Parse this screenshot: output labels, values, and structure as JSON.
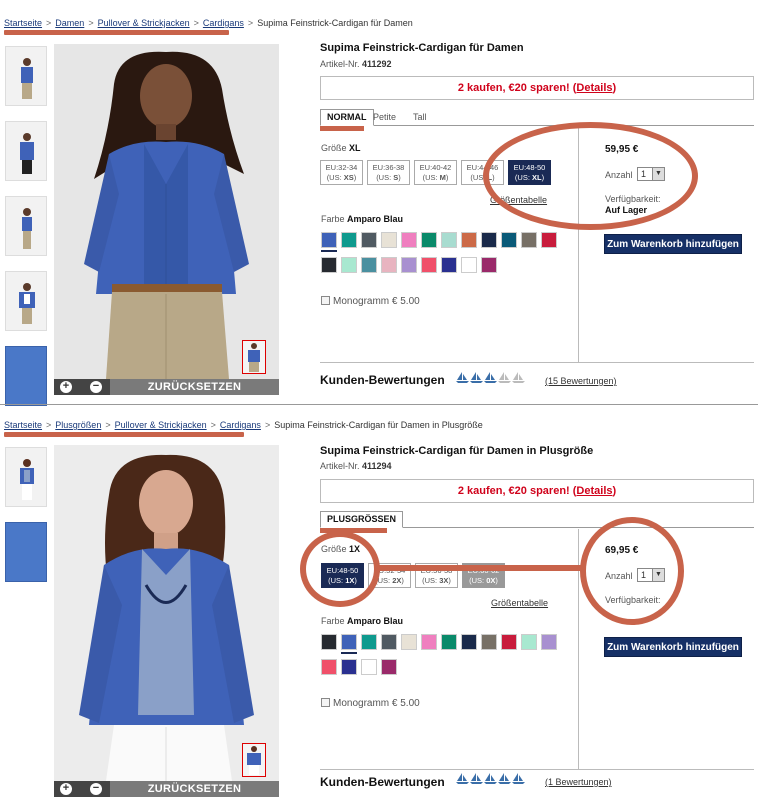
{
  "colors": {
    "highlight": "#c8634a",
    "navy": "#1a2a55",
    "promo_red": "#d0021b",
    "cart_button": "#163066",
    "boat_blue": "#3a6ea8",
    "boat_grey": "#bbbbbb"
  },
  "panel1": {
    "breadcrumb": {
      "links": [
        "Startseite",
        "Damen",
        "Pullover & Strickjacken",
        "Cardigans"
      ],
      "current": "Supima Feinstrick-Cardigan für Damen",
      "separator": ">"
    },
    "product_title": "Supima Feinstrick-Cardigan für Damen",
    "article_label": "Artikel-Nr.",
    "article_number": "411292",
    "promo_text": "2 kaufen, €20 sparen! (",
    "promo_link": "Details",
    "promo_close": ")",
    "tabs": [
      "NORMAL",
      "Petite",
      "Tall"
    ],
    "size_label": "Größe",
    "size_selected": "XL",
    "sizes": [
      {
        "eu": "EU:32-34",
        "us_prefix": "(US: ",
        "us": "XS",
        "us_suffix": ")",
        "state": "normal"
      },
      {
        "eu": "EU:36-38",
        "us_prefix": "(US: ",
        "us": "S",
        "us_suffix": ")",
        "state": "normal"
      },
      {
        "eu": "EU:40-42",
        "us_prefix": "(US: ",
        "us": "M",
        "us_suffix": ")",
        "state": "normal"
      },
      {
        "eu": "EU:44-46",
        "us_prefix": "(US: ",
        "us": "L",
        "us_suffix": ")",
        "state": "normal"
      },
      {
        "eu": "EU:48-50",
        "us_prefix": "(US: ",
        "us": "XL",
        "us_suffix": ")",
        "state": "selected"
      }
    ],
    "size_chart_link": "Größentabelle",
    "color_label": "Farbe",
    "color_selected": "Amparo Blau",
    "swatches": [
      "#3f62b8",
      "#0f9a8e",
      "#505a62",
      "#e8e2d6",
      "#ef7fbf",
      "#0a8a6a",
      "#a8dcd0",
      "#cc6a48",
      "#1a2a4a",
      "#0a5a78",
      "#777066",
      "#c81c3c",
      "#262a30",
      "#a8e8d0",
      "#4a90a0",
      "#e8b4c0",
      "#a890d0",
      "#f0506a",
      "#2a3090",
      "#ffffff",
      "#9a2a6a"
    ],
    "monogram_label": "Monogramm € 5.00",
    "price": "59,95 €",
    "qty_label": "Anzahl",
    "qty_value": "1",
    "availability_label": "Verfügbarkeit:",
    "availability_value": "Auf Lager",
    "cart_button": "Zum Warenkorb hinzufügen",
    "reviews_title": "Kunden-Bewertungen",
    "rating": 3,
    "rating_max": 5,
    "reviews_link": "(15 Bewertungen)",
    "reset_label": "ZURÜCKSETZEN",
    "zoom_in": "+",
    "zoom_out": "−"
  },
  "panel2": {
    "breadcrumb": {
      "links": [
        "Startseite",
        "Plusgrößen",
        "Pullover & Strickjacken",
        "Cardigans"
      ],
      "current": "Supima Feinstrick-Cardigan für Damen in Plusgröße",
      "separator": ">"
    },
    "product_title": "Supima Feinstrick-Cardigan für Damen in Plusgröße",
    "article_label": "Artikel-Nr.",
    "article_number": "411294",
    "promo_text": "2 kaufen, €20 sparen! (",
    "promo_link": "Details",
    "promo_close": ")",
    "tabs": [
      "PLUSGRÖSSEN"
    ],
    "size_label": "Größe",
    "size_selected": "1X",
    "sizes": [
      {
        "eu": "EU:48-50",
        "us_prefix": "(US: ",
        "us": "1X",
        "us_suffix": ")",
        "state": "selected"
      },
      {
        "eu": "EU:52-54",
        "us_prefix": "(US: ",
        "us": "2X",
        "us_suffix": ")",
        "state": "normal"
      },
      {
        "eu": "EU:56-58",
        "us_prefix": "(US: ",
        "us": "3X",
        "us_suffix": ")",
        "state": "normal"
      },
      {
        "eu": "EU:60-62",
        "us_prefix": "(US: ",
        "us": "0X",
        "us_suffix": ")",
        "state": "unavailable"
      }
    ],
    "size_chart_link": "Größentabelle",
    "color_label": "Farbe",
    "color_selected": "Amparo Blau",
    "swatches": [
      "#262a30",
      "#3f62b8",
      "#0f9a8e",
      "#505a62",
      "#e8e2d6",
      "#ef7fbf",
      "#0a8a6a",
      "#1a2a4a",
      "#777066",
      "#c81c3c",
      "#a8e8d0",
      "#a890d0",
      "#f0506a",
      "#2a3090",
      "#ffffff",
      "#9a2a6a"
    ],
    "monogram_label": "Monogramm € 5.00",
    "price": "69,95 €",
    "qty_label": "Anzahl",
    "qty_value": "1",
    "availability_label": "Verfügbarkeit:",
    "cart_button": "Zum Warenkorb hinzufügen",
    "reviews_title": "Kunden-Bewertungen",
    "rating": 5,
    "rating_max": 5,
    "reviews_link": "(1 Bewertungen)",
    "reset_label": "ZURÜCKSETZEN",
    "zoom_in": "+",
    "zoom_out": "−"
  }
}
